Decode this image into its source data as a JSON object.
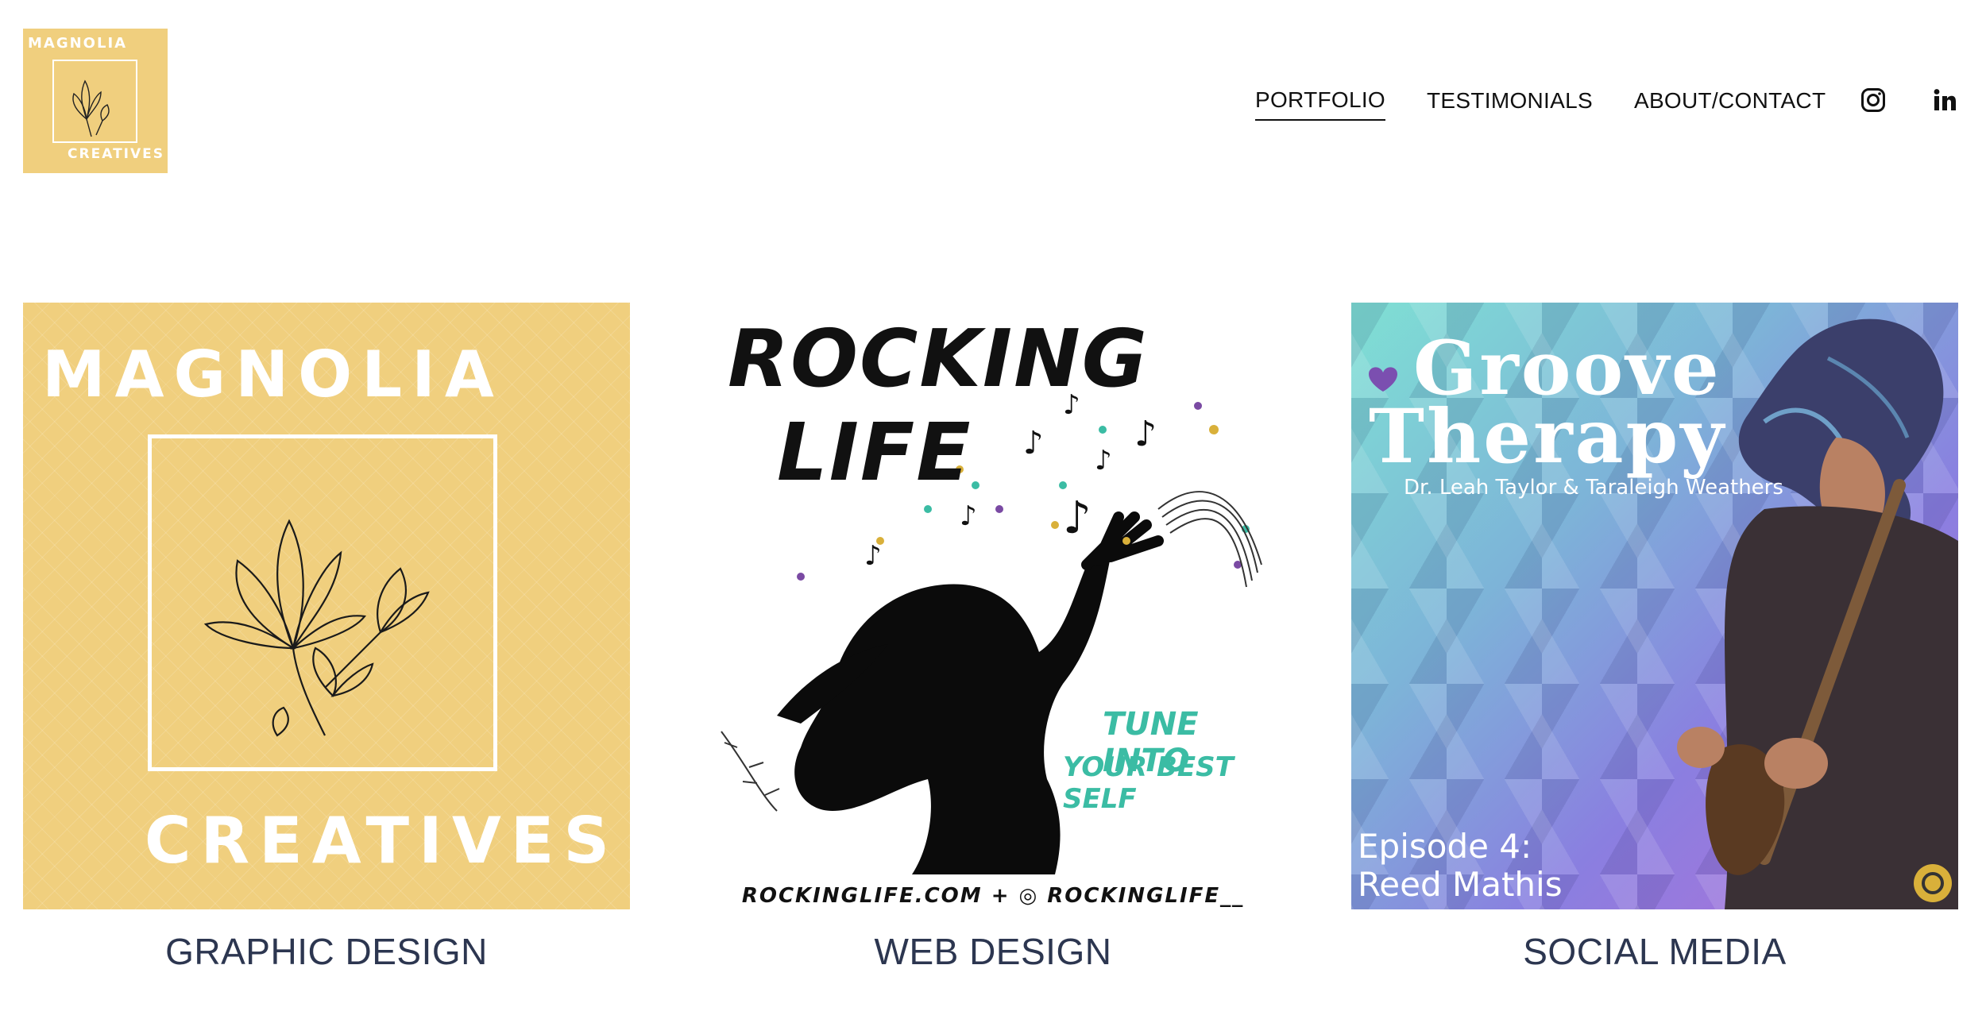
{
  "header": {
    "logo": {
      "line1": "MAGNOLIA",
      "line2": "CREATIVES"
    },
    "nav": [
      {
        "label": "PORTFOLIO",
        "active": true
      },
      {
        "label": "TESTIMONIALS",
        "active": false
      },
      {
        "label": "ABOUT/CONTACT",
        "active": false
      }
    ],
    "social": [
      "instagram-icon",
      "linkedin-icon"
    ]
  },
  "portfolio": [
    {
      "caption": "GRAPHIC DESIGN",
      "art": {
        "word1": "MAGNOLIA",
        "word2": "CREATIVES"
      }
    },
    {
      "caption": "WEB DESIGN",
      "art": {
        "title1": "ROCKING",
        "title2": "LIFE",
        "tag1": "TUNE INTO",
        "tag2": "YOUR BEST SELF",
        "footer": "ROCKINGLIFE.COM + ◎ ROCKINGLIFE__"
      }
    },
    {
      "caption": "SOCIAL MEDIA",
      "art": {
        "title1": "Groove",
        "title2": "Therapy",
        "hosts": "Dr. Leah Taylor & Taraleigh Weathers",
        "episode": "Episode 4:",
        "guest": "Reed Mathis"
      }
    }
  ],
  "colors": {
    "gold": "#f0cf7e",
    "caption": "#2c3650",
    "teal": "#3bbca4"
  }
}
